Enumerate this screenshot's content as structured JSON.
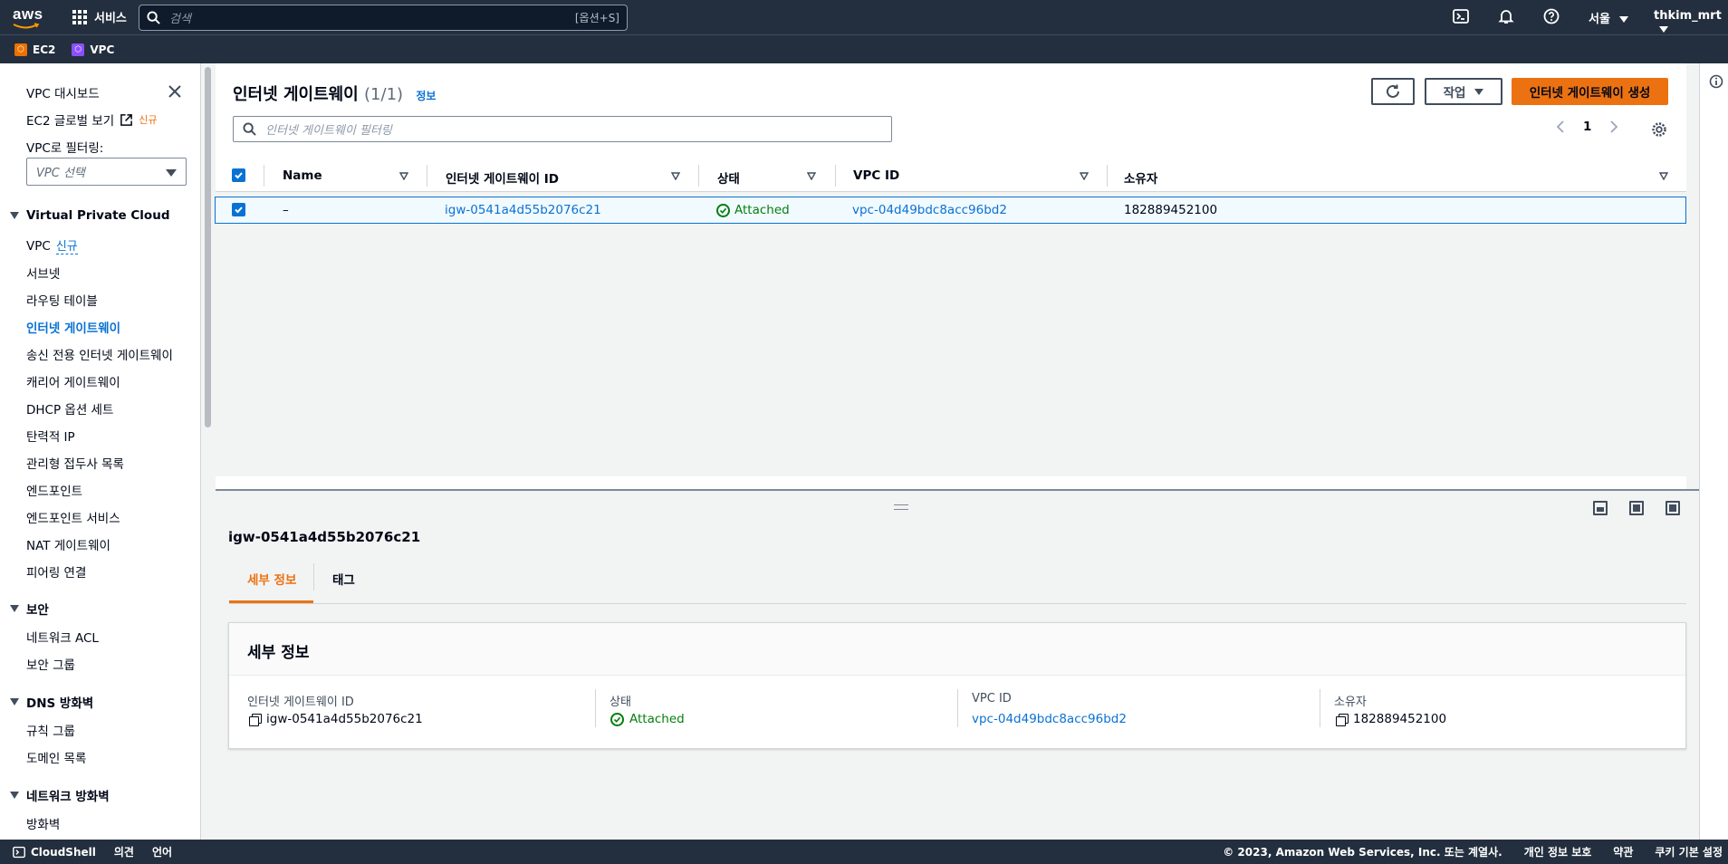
{
  "topnav": {
    "logo": "aws",
    "services_label": "서비스",
    "search_placeholder": "검색",
    "search_shortcut": "[옵션+S]",
    "region": "서울",
    "user": "thkim_mrt"
  },
  "favorites": [
    {
      "label": "EC2",
      "color": "#ed7100"
    },
    {
      "label": "VPC",
      "color": "#8c4fff"
    }
  ],
  "sidebar": {
    "dashboard": "VPC 대시보드",
    "ec2_global": "EC2 글로벌 보기",
    "ec2_global_badge": "신규",
    "filter_label": "VPC로 필터링:",
    "vpc_select_placeholder": "VPC 선택",
    "sections": [
      {
        "title": "Virtual Private Cloud",
        "items": [
          "VPC",
          "서브넷",
          "라우팅 테이블",
          "인터넷 게이트웨이",
          "송신 전용 인터넷 게이트웨이",
          "캐리어 게이트웨이",
          "DHCP 옵션 세트",
          "탄력적 IP",
          "관리형 접두사 목록",
          "엔드포인트",
          "엔드포인트 서비스",
          "NAT 게이트웨이",
          "피어링 연결"
        ]
      },
      {
        "title": "보안",
        "items": [
          "네트워크 ACL",
          "보안 그룹"
        ]
      },
      {
        "title": "DNS 방화벽",
        "items": [
          "규칙 그룹",
          "도메인 목록"
        ]
      },
      {
        "title": "네트워크 방화벽",
        "items": [
          "방화벽"
        ]
      }
    ],
    "vpc_new_label": "신규",
    "active_item": "인터넷 게이트웨이"
  },
  "list": {
    "title": "인터넷 게이트웨이",
    "count": "(1/1)",
    "info_link": "정보",
    "actions_label": "작업",
    "create_label": "인터넷 게이트웨이 생성",
    "filter_placeholder": "인터넷 게이트웨이 필터링",
    "page": "1",
    "columns": [
      "Name",
      "인터넷 게이트웨이 ID",
      "상태",
      "VPC ID",
      "소유자"
    ],
    "rows": [
      {
        "name": "–",
        "id": "igw-0541a4d55b2076c21",
        "state": "Attached",
        "vpc_id": "vpc-04d49bdc8acc96bd2",
        "owner": "182889452100"
      }
    ]
  },
  "details": {
    "resource_id": "igw-0541a4d55b2076c21",
    "tabs": [
      "세부 정보",
      "태그"
    ],
    "card_title": "세부 정보",
    "fields": [
      {
        "label": "인터넷 게이트웨이 ID",
        "value": "igw-0541a4d55b2076c21"
      },
      {
        "label": "상태",
        "value": "Attached"
      },
      {
        "label": "VPC ID",
        "value": "vpc-04d49bdc8acc96bd2"
      },
      {
        "label": "소유자",
        "value": "182889452100"
      }
    ]
  },
  "footer": {
    "cloudshell": "CloudShell",
    "feedback": "의견",
    "language": "언어",
    "copyright": "© 2023, Amazon Web Services, Inc. 또는 계열사.",
    "privacy": "개인 정보 보호",
    "terms": "약관",
    "cookies": "쿠키 기본 설정"
  }
}
